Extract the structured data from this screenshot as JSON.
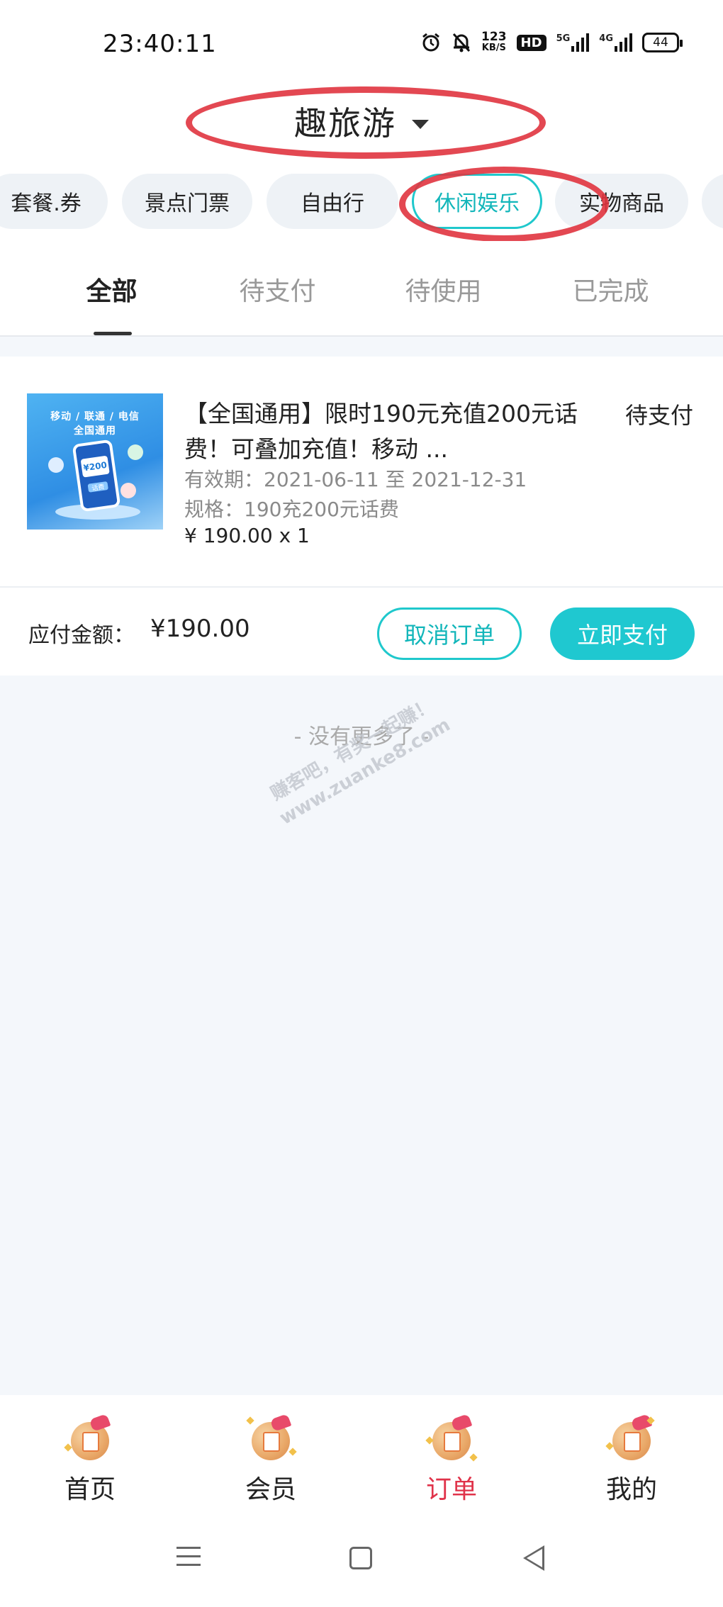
{
  "status_bar": {
    "time": "23:40:11",
    "net_speed_value": "123",
    "net_speed_unit": "KB/S",
    "hd_label": "HD",
    "net_5g": "5G",
    "net_4g": "4G",
    "battery": "44"
  },
  "header": {
    "title": "趣旅游"
  },
  "categories": [
    {
      "label": "套餐.券"
    },
    {
      "label": "景点门票"
    },
    {
      "label": "自由行"
    },
    {
      "label": "休闲娱乐"
    },
    {
      "label": "实物商品"
    }
  ],
  "order_tabs": [
    {
      "label": "全部"
    },
    {
      "label": "待支付"
    },
    {
      "label": "待使用"
    },
    {
      "label": "已完成"
    }
  ],
  "order": {
    "thumb_line1": "移动 / 联通 / 电信",
    "thumb_line2": "全国通用",
    "thumb_value": "¥200",
    "thumb_sub": "话费",
    "title": "【全国通用】限时190元充值200元话费！可叠加充值！移动 ...",
    "status": "待支付",
    "validity": "有效期：2021-06-11 至 2021-12-31",
    "spec": "规格：190充200元话费",
    "price_qty": "¥ 190.00   x 1",
    "pay_label": "应付金额：",
    "pay_amount": "¥190.00",
    "cancel_label": "取消订单",
    "pay_now_label": "立即支付"
  },
  "footer_note": "- 没有更多了 -",
  "watermark": {
    "line1": "赚客吧，有奖一起赚！",
    "line2": "www.zuanke8.com"
  },
  "bottom_nav": [
    {
      "label": "首页"
    },
    {
      "label": "会员"
    },
    {
      "label": "订单"
    },
    {
      "label": "我的"
    }
  ],
  "colors": {
    "accent": "#1fc8cc",
    "active_nav": "#e0334a",
    "annotation": "#e0343f"
  }
}
